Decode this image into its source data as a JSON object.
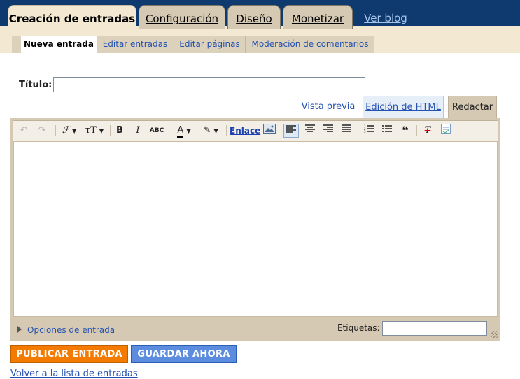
{
  "top_nav": {
    "tabs": [
      {
        "label": "Creación de entradas",
        "active": true
      },
      {
        "label": "Configuración",
        "active": false
      },
      {
        "label": "Diseño",
        "active": false
      },
      {
        "label": "Monetizar",
        "active": false
      }
    ],
    "view_blog": "Ver blog"
  },
  "sub_nav": {
    "tabs": [
      {
        "label": "Nueva entrada",
        "active": true
      },
      {
        "label": "Editar entradas",
        "active": false
      },
      {
        "label": "Editar páginas",
        "active": false
      },
      {
        "label": "Moderación de comentarios",
        "active": false
      }
    ]
  },
  "post": {
    "title_label": "Título:",
    "title_value": ""
  },
  "editor_modes": {
    "preview": "Vista previa",
    "html": "Edición de HTML",
    "compose": "Redactar"
  },
  "toolbar": {
    "link_label": "Enlace",
    "icons": [
      "undo-icon",
      "redo-icon",
      "font-icon",
      "font-size-icon",
      "bold-icon",
      "italic-icon",
      "strikethrough-icon",
      "text-color-icon",
      "highlight-icon",
      "image-icon",
      "align-left-icon",
      "align-center-icon",
      "align-right-icon",
      "justify-icon",
      "numbered-list-icon",
      "bullet-list-icon",
      "quote-icon",
      "remove-format-icon",
      "spellcheck-icon"
    ]
  },
  "footer": {
    "options_label": "Opciones de entrada",
    "tags_label": "Etiquetas:",
    "tags_value": "",
    "publish_button": "PUBLICAR ENTRADA",
    "save_button": "GUARDAR AHORA",
    "back_link": "Volver a la lista de entradas"
  },
  "colors": {
    "nav_bg": "#0e3a70",
    "tab_bg": "#d5c9b3",
    "active_bg": "#f3e8d2",
    "publish": "#f47b00",
    "save": "#5b8cde",
    "link": "#2552b0"
  }
}
